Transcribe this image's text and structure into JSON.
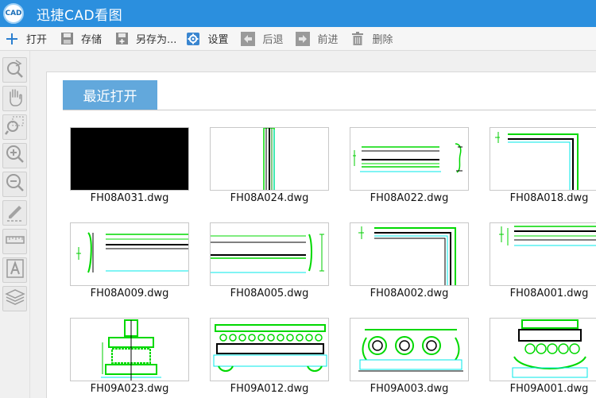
{
  "app": {
    "title": "迅捷CAD看图",
    "logo_text": "CAD"
  },
  "toolbar": [
    {
      "label": "打开",
      "icon": "plus-icon"
    },
    {
      "label": "存储",
      "icon": "save-icon"
    },
    {
      "label": "另存为...",
      "icon": "save-as-icon"
    },
    {
      "label": "设置",
      "icon": "gear-icon"
    },
    {
      "label": "后退",
      "icon": "back-arrow-icon"
    },
    {
      "label": "前进",
      "icon": "forward-arrow-icon"
    },
    {
      "label": "删除",
      "icon": "trash-icon"
    }
  ],
  "tools": [
    "zoom-reset-icon",
    "pan-hand-icon",
    "zoom-window-icon",
    "zoom-in-icon",
    "zoom-out-icon",
    "pencil-icon",
    "measure-ruler-icon",
    "text-icon",
    "layers-icon"
  ],
  "recent": {
    "tab_label": "最近打开",
    "files": [
      {
        "name": "FH08A031.dwg"
      },
      {
        "name": "FH08A024.dwg"
      },
      {
        "name": "FH08A022.dwg"
      },
      {
        "name": "FH08A018.dwg"
      },
      {
        "name": "FH08A009.dwg"
      },
      {
        "name": "FH08A005.dwg"
      },
      {
        "name": "FH08A002.dwg"
      },
      {
        "name": "FH08A001.dwg"
      },
      {
        "name": "FH09A023.dwg"
      },
      {
        "name": "FH09A012.dwg"
      },
      {
        "name": "FH09A003.dwg"
      },
      {
        "name": "FH09A001.dwg"
      }
    ]
  },
  "colors": {
    "titlebar": "#2b8fde",
    "tab": "#62a8dc",
    "cad_green": "#00e000",
    "cad_cyan": "#00ffff"
  }
}
